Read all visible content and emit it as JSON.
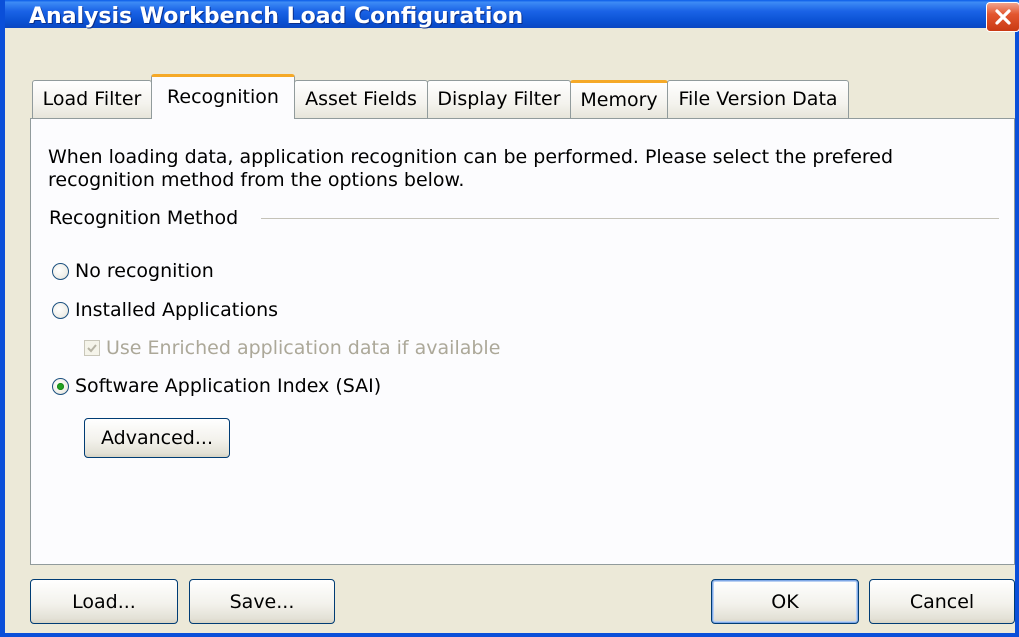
{
  "window": {
    "title": "Analysis Workbench Load Configuration"
  },
  "tabs": [
    {
      "label": "Load Filter"
    },
    {
      "label": "Recognition"
    },
    {
      "label": "Asset Fields"
    },
    {
      "label": "Display Filter"
    },
    {
      "label": "Memory"
    },
    {
      "label": "File Version Data"
    }
  ],
  "active_tab": "Recognition",
  "recognition": {
    "intro": "When loading data, application recognition can be performed.  Please select the prefered recognition method from the options below.",
    "group_label": "Recognition Method",
    "options": [
      {
        "label": "No recognition",
        "selected": false
      },
      {
        "label": "Installed Applications",
        "selected": false
      },
      {
        "label": "Software Application Index  (SAI)",
        "selected": true
      }
    ],
    "enriched_checkbox": {
      "label": "Use Enriched application data if available",
      "checked": true,
      "enabled": false
    },
    "advanced_label": "Advanced..."
  },
  "footer": {
    "load_label": "Load...",
    "save_label": "Save...",
    "ok_label": "OK",
    "cancel_label": "Cancel"
  },
  "colors": {
    "titlebar": "#0b52d4",
    "tab_highlight": "#f5a927",
    "radio_selected": "#21a121",
    "dialog_bg": "#ece9d8"
  }
}
